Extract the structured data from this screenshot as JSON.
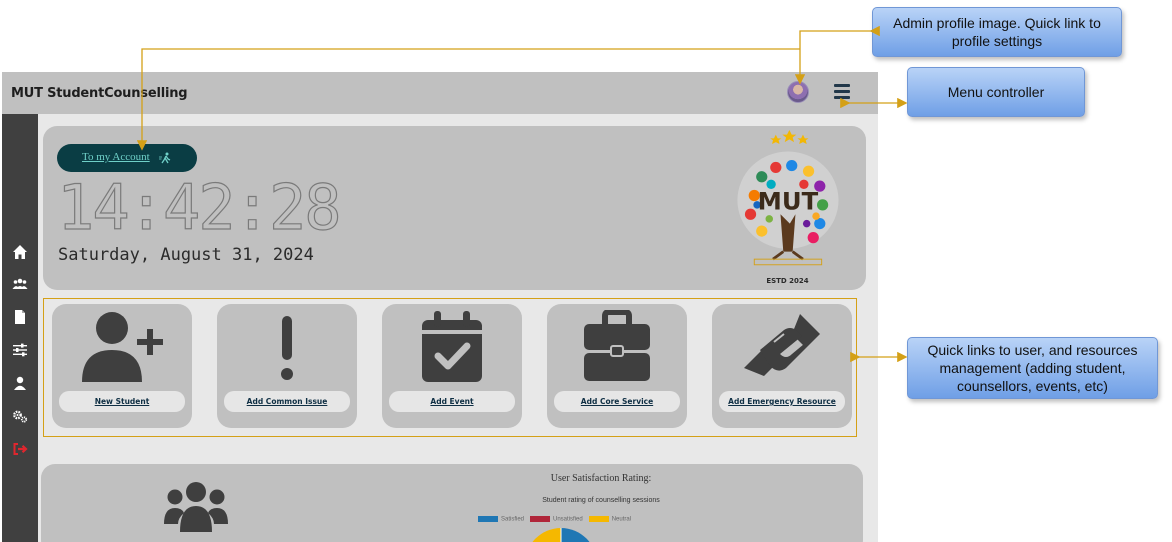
{
  "app": {
    "brand": "MUT StudentCounselling",
    "menu_icon": "hamburger-menu-icon",
    "avatar_icon": "admin-avatar-icon"
  },
  "sidebar": {
    "items": [
      {
        "icon": "home-icon"
      },
      {
        "icon": "users-icon"
      },
      {
        "icon": "document-icon"
      },
      {
        "icon": "sliders-icon"
      },
      {
        "icon": "user-icon"
      },
      {
        "icon": "gears-icon"
      },
      {
        "icon": "logout-icon"
      }
    ]
  },
  "hero": {
    "account_link": "To my Account",
    "time": "14:42:28",
    "date": "Saturday, August 31, 2024",
    "logo_text": "MUT",
    "logo_estd": "ESTD 2024"
  },
  "quick_links": [
    {
      "label": "New Student",
      "icon": "user-plus-icon"
    },
    {
      "label": "Add Common Issue",
      "icon": "exclamation-icon"
    },
    {
      "label": "Add Event",
      "icon": "calendar-check-icon"
    },
    {
      "label": "Add Core Service",
      "icon": "briefcase-icon"
    },
    {
      "label": "Add Emergency Resource",
      "icon": "handshake-icon"
    }
  ],
  "satisfaction": {
    "title": "User Satisfaction Rating:",
    "subtitle": "Student rating of counselling sessions",
    "legend": [
      {
        "label": "Satisfied",
        "color": "#1f77b4"
      },
      {
        "label": "Unsatisfied",
        "color": "#b0263a"
      },
      {
        "label": "Neutral",
        "color": "#f5b800"
      }
    ]
  },
  "annotations": {
    "profile": "Admin profile image. Quick link to profile settings",
    "menu": "Menu controller",
    "quick": "Quick links to user, and resources management (adding student, counsellors, events, etc)"
  },
  "colors": {
    "accent_gold": "#d4a017",
    "account_pill": "#0a3d44",
    "sidebar_bg": "#404040",
    "panel_bg": "#c0c0c0"
  }
}
